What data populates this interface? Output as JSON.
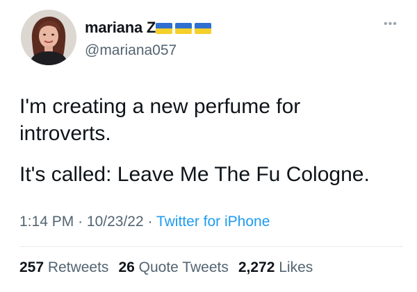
{
  "author": {
    "display_name": "mariana Z",
    "flags": [
      "ukraine-flag-icon",
      "ukraine-flag-icon",
      "ukraine-flag-icon"
    ],
    "handle": "@mariana057"
  },
  "more_icon": "ellipsis-icon",
  "tweet": {
    "lines": [
      "I'm creating a new perfume for",
      "introverts.",
      "It's called: Leave Me The Fu Cologne."
    ]
  },
  "meta": {
    "time": "1:14 PM",
    "date": "10/23/22",
    "separator": "·",
    "source": "Twitter for iPhone"
  },
  "stats": {
    "retweets_count": "257",
    "retweets_label": "Retweets",
    "quotes_count": "26",
    "quotes_label": "Quote Tweets",
    "likes_count": "2,272",
    "likes_label": "Likes"
  },
  "colors": {
    "link": "#1d9bf0",
    "secondary_text": "#536471",
    "flag_blue": "#2e6fd0",
    "flag_yellow": "#f5cf2a"
  }
}
